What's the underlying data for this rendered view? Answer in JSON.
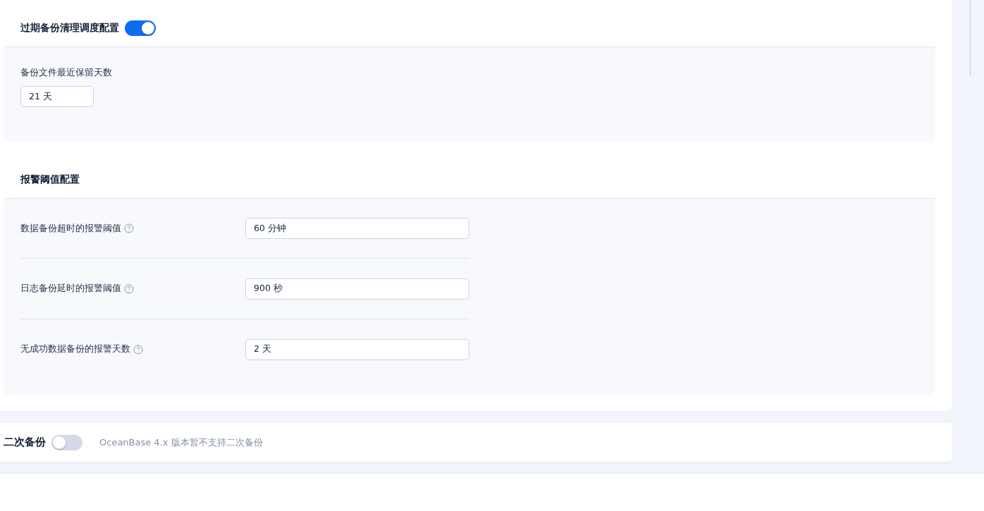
{
  "sections": [
    {
      "title": "过期备份清理调度配置",
      "toggle": {
        "on": true
      },
      "kind": "stacked",
      "fields": [
        {
          "label": "备份文件最近保留天数",
          "value": "21 天"
        }
      ]
    },
    {
      "title": "报警阈值配置",
      "kind": "rows",
      "fields": [
        {
          "label": "数据备份超时的报警阈值",
          "value": "60 分钟",
          "help": true
        },
        {
          "label": "日志备份延时的报警阈值",
          "value": "900 秒",
          "help": true
        },
        {
          "label": "无成功数据备份的报警天数",
          "value": "2 天",
          "help": true
        }
      ]
    }
  ],
  "secondary": {
    "title": "二次备份",
    "toggle": {
      "on": false
    },
    "note": "OceanBase 4.x 版本暂不支持二次备份"
  }
}
